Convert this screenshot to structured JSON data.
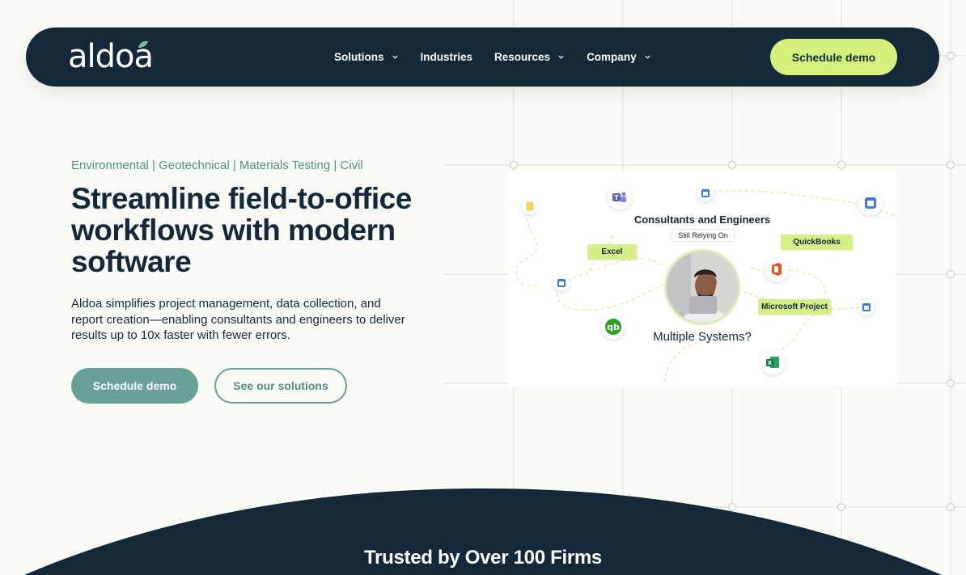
{
  "nav": {
    "logo": "aldoa",
    "items": [
      {
        "label": "Solutions",
        "has_dropdown": true
      },
      {
        "label": "Industries",
        "has_dropdown": false
      },
      {
        "label": "Resources",
        "has_dropdown": true
      },
      {
        "label": "Company",
        "has_dropdown": true
      }
    ],
    "cta": "Schedule demo"
  },
  "hero": {
    "eyebrow": "Environmental | Geotechnical | Materials Testing | Civil",
    "headline": "Streamline field-to-office workflows with modern software",
    "lead": "Aldoa simplifies project management, data collection, and report creation—enabling consultants and engineers to deliver results up to 10x faster with fewer errors.",
    "primary_button": "Schedule demo",
    "secondary_button": "See our solutions"
  },
  "illustration": {
    "title": "Consultants and Engineers",
    "subtitle_tag": "Still Relying On",
    "tags": [
      "Excel",
      "QuickBooks",
      "Microsoft Project"
    ],
    "question": "Multiple Systems?",
    "icons": [
      "teams-icon",
      "office-icon",
      "quickbooks-icon",
      "excel-icon",
      "calendar-icon",
      "sticky-note-icon"
    ]
  },
  "trusted": {
    "heading": "Trusted by Over 100 Firms"
  },
  "colors": {
    "navy": "#13293a",
    "lime": "#d6f27a",
    "teal": "#66a097",
    "background": "#fbfbf6"
  }
}
